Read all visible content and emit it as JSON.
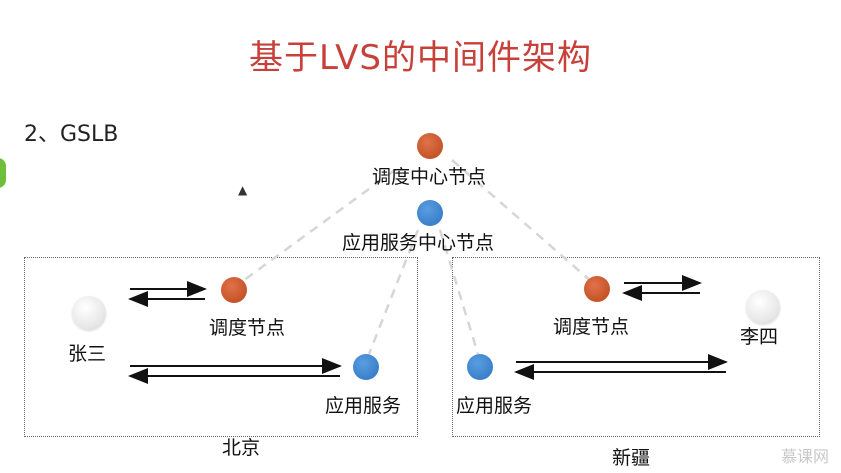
{
  "slide": {
    "title": "基于LVS的中间件架构",
    "subtitle": "2、GSLB"
  },
  "nodes": {
    "scheduler_center": "调度中心节点",
    "app_center": "应用服务中心节点",
    "beijing_scheduler": "调度节点",
    "beijing_app": "应用服务",
    "beijing_user": "张三",
    "xinjiang_scheduler": "调度节点",
    "xinjiang_app": "应用服务",
    "xinjiang_user": "李四"
  },
  "regions": {
    "beijing": "北京",
    "xinjiang": "新疆"
  },
  "watermark": "慕课网",
  "colors": {
    "title": "#c8403a",
    "scheduler_node": "#c55428",
    "app_node": "#3b80cc"
  }
}
